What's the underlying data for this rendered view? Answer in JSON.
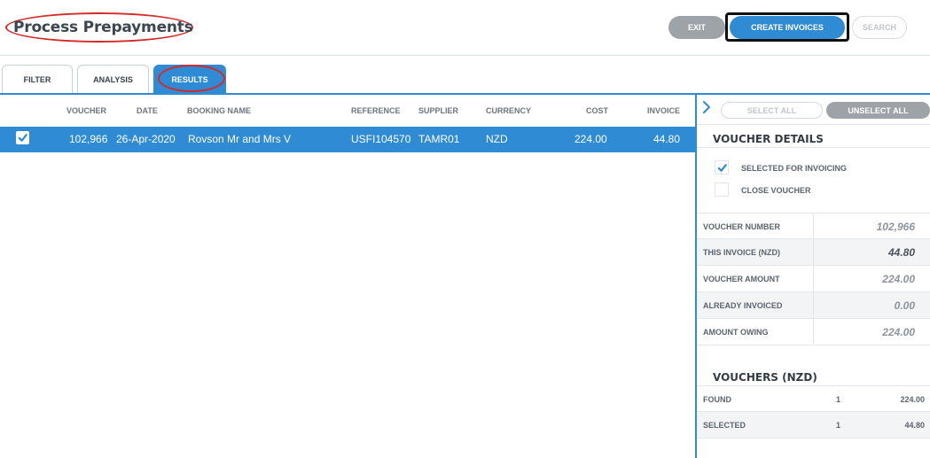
{
  "header": {
    "title": "Process Prepayments",
    "exit_label": "EXIT",
    "create_label": "CREATE INVOICES",
    "search_label": "SEARCH"
  },
  "tabs": [
    {
      "label": "FILTER",
      "active": false
    },
    {
      "label": "ANALYSIS",
      "active": false
    },
    {
      "label": "RESULTS",
      "active": true
    }
  ],
  "table": {
    "columns": [
      "VOUCHER",
      "DATE",
      "BOOKING NAME",
      "REFERENCE",
      "SUPPLIER",
      "CURRENCY",
      "COST",
      "INVOICE"
    ],
    "rows": [
      {
        "checked": true,
        "voucher": "102,966",
        "date": "26-Apr-2020",
        "booking_name": "Rovson Mr and Mrs V",
        "reference": "USFI104570",
        "supplier": "TAMR01",
        "currency": "NZD",
        "cost": "224.00",
        "invoice": "44.80"
      }
    ]
  },
  "panel": {
    "select_all_label": "SELECT ALL",
    "unselect_all_label": "UNSELECT ALL",
    "voucher_details_title": "VOUCHER DETAILS",
    "selected_for_invoicing_label": "SELECTED FOR INVOICING",
    "selected_for_invoicing_checked": true,
    "close_voucher_label": "CLOSE VOUCHER",
    "close_voucher_checked": false,
    "details": [
      {
        "label": "VOUCHER NUMBER",
        "value": "102,966"
      },
      {
        "label": "THIS INVOICE (NZD)",
        "value": "44.80"
      },
      {
        "label": "VOUCHER AMOUNT",
        "value": "224.00"
      },
      {
        "label": "ALREADY INVOICED",
        "value": "0.00"
      },
      {
        "label": "AMOUNT OWING",
        "value": "224.00"
      }
    ],
    "vouchers_title": "VOUCHERS (NZD)",
    "summary": [
      {
        "label": "FOUND",
        "count": "1",
        "amount": "224.00"
      },
      {
        "label": "SELECTED",
        "count": "1",
        "amount": "44.80"
      }
    ]
  },
  "colors": {
    "accent": "#2f8bd4",
    "annotation": "#d42a2a",
    "grey_button": "#9ea3a8"
  }
}
